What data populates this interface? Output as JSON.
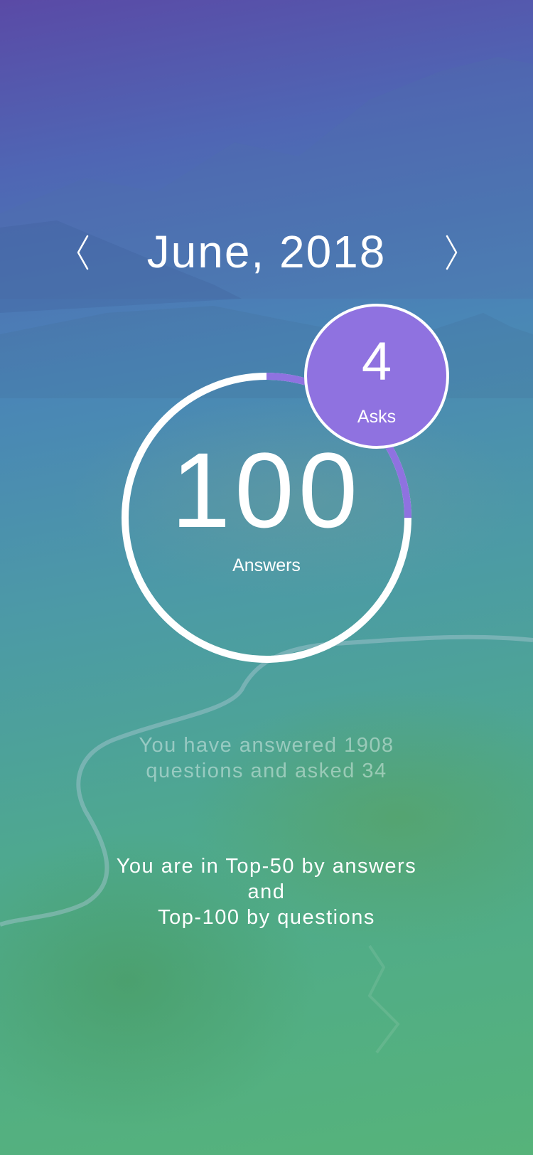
{
  "header": {
    "month_title": "June, 2018",
    "prev_icon": "chevron-left-icon",
    "next_icon": "chevron-right-icon"
  },
  "stats": {
    "answers_count": "100",
    "answers_label": "Answers",
    "answers_progress": 0.25,
    "asks_count": "4",
    "asks_label": "Asks"
  },
  "summary": {
    "line1": "You have answered 1908",
    "line2": "questions and asked 34"
  },
  "rank": {
    "line1": "You are in Top-50 by answers",
    "line2": "and",
    "line3": "Top-100 by questions"
  },
  "colors": {
    "accent": "#8f72e0",
    "ring": "#ffffff"
  }
}
